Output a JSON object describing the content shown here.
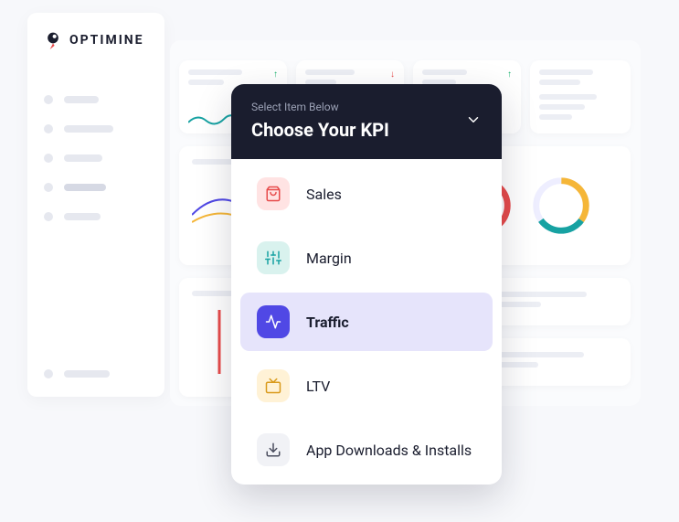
{
  "brand": {
    "name": "OPTIMINE"
  },
  "dropdown": {
    "subtitle": "Select Item Below",
    "title": "Choose Your KPI",
    "items": [
      {
        "label": "Sales",
        "icon": "shopping-bag-icon",
        "selected": false
      },
      {
        "label": "Margin",
        "icon": "sliders-icon",
        "selected": false
      },
      {
        "label": "Traffic",
        "icon": "activity-icon",
        "selected": true
      },
      {
        "label": "LTV",
        "icon": "tv-icon",
        "selected": false
      },
      {
        "label": "App Downloads & Installs",
        "icon": "download-icon",
        "selected": false
      }
    ]
  },
  "colors": {
    "accent": "#5048e5",
    "danger": "#e74b4b",
    "success": "#19b26e",
    "warn": "#f5b638",
    "teal": "#17a2a2"
  }
}
